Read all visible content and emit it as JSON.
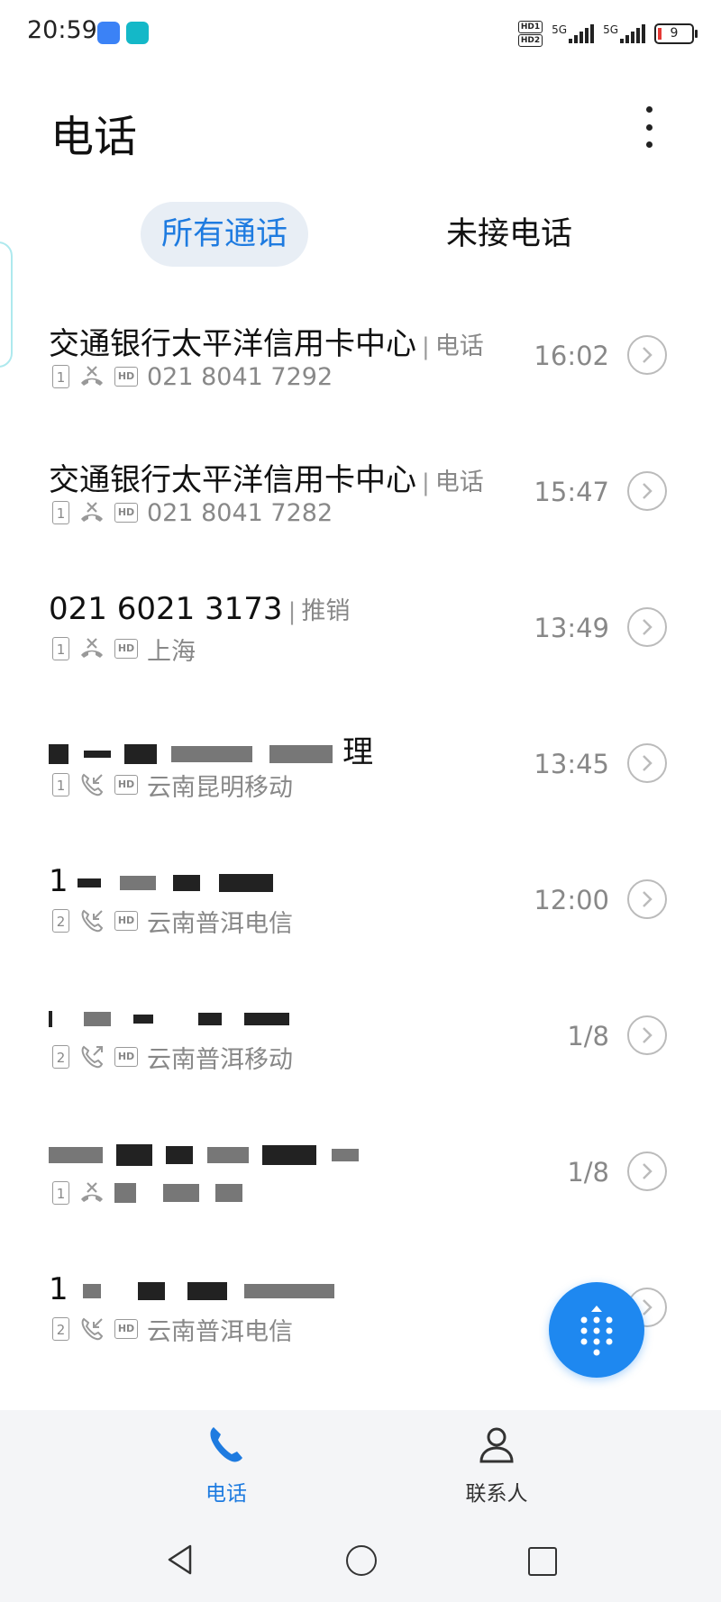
{
  "status_bar": {
    "time": "20:59",
    "network1": "5G",
    "network2": "5G",
    "battery": "9",
    "hd1": "HD1",
    "hd2": "HD2"
  },
  "header": {
    "title": "电话",
    "menu_icon": "more-vertical-icon"
  },
  "tabs": [
    {
      "label": "所有通话",
      "selected": true
    },
    {
      "label": "未接电话",
      "selected": false
    }
  ],
  "calls": [
    {
      "name": "交通银行太平洋信用卡中心",
      "tag": "电话",
      "sim": "1",
      "type": "missed",
      "detail": "021 8041 7292",
      "time": "16:02"
    },
    {
      "name": "交通银行太平洋信用卡中心",
      "tag": "电话",
      "sim": "1",
      "type": "missed",
      "detail": "021 8041 7282",
      "time": "15:47"
    },
    {
      "name": "021 6021 3173",
      "tag": "推销",
      "sim": "1",
      "type": "missed",
      "detail": "上海",
      "time": "13:49"
    },
    {
      "name": "理",
      "tag": "",
      "sim": "1",
      "type": "incoming",
      "detail": "云南昆明移动",
      "time": "13:45"
    },
    {
      "name": "1",
      "tag": "",
      "sim": "2",
      "type": "incoming",
      "detail": "云南普洱电信",
      "time": "12:00"
    },
    {
      "name": "",
      "tag": "",
      "sim": "2",
      "type": "outgoing",
      "detail": "云南普洱移动",
      "time": "1/8"
    },
    {
      "name": "",
      "tag": "",
      "sim": "1",
      "type": "missed",
      "detail": "",
      "time": "1/8"
    },
    {
      "name": "1",
      "tag": "",
      "sim": "2",
      "type": "incoming",
      "detail": "云南普洱电信",
      "time": ""
    }
  ],
  "colors": {
    "accent": "#1e7be0",
    "fab": "#1e88f0",
    "missed_icon": "#999999"
  },
  "fab": {
    "icon": "dialpad-icon"
  },
  "bottom_nav": [
    {
      "label": "电话",
      "icon": "phone-icon",
      "active": true
    },
    {
      "label": "联系人",
      "icon": "person-icon",
      "active": false
    }
  ]
}
